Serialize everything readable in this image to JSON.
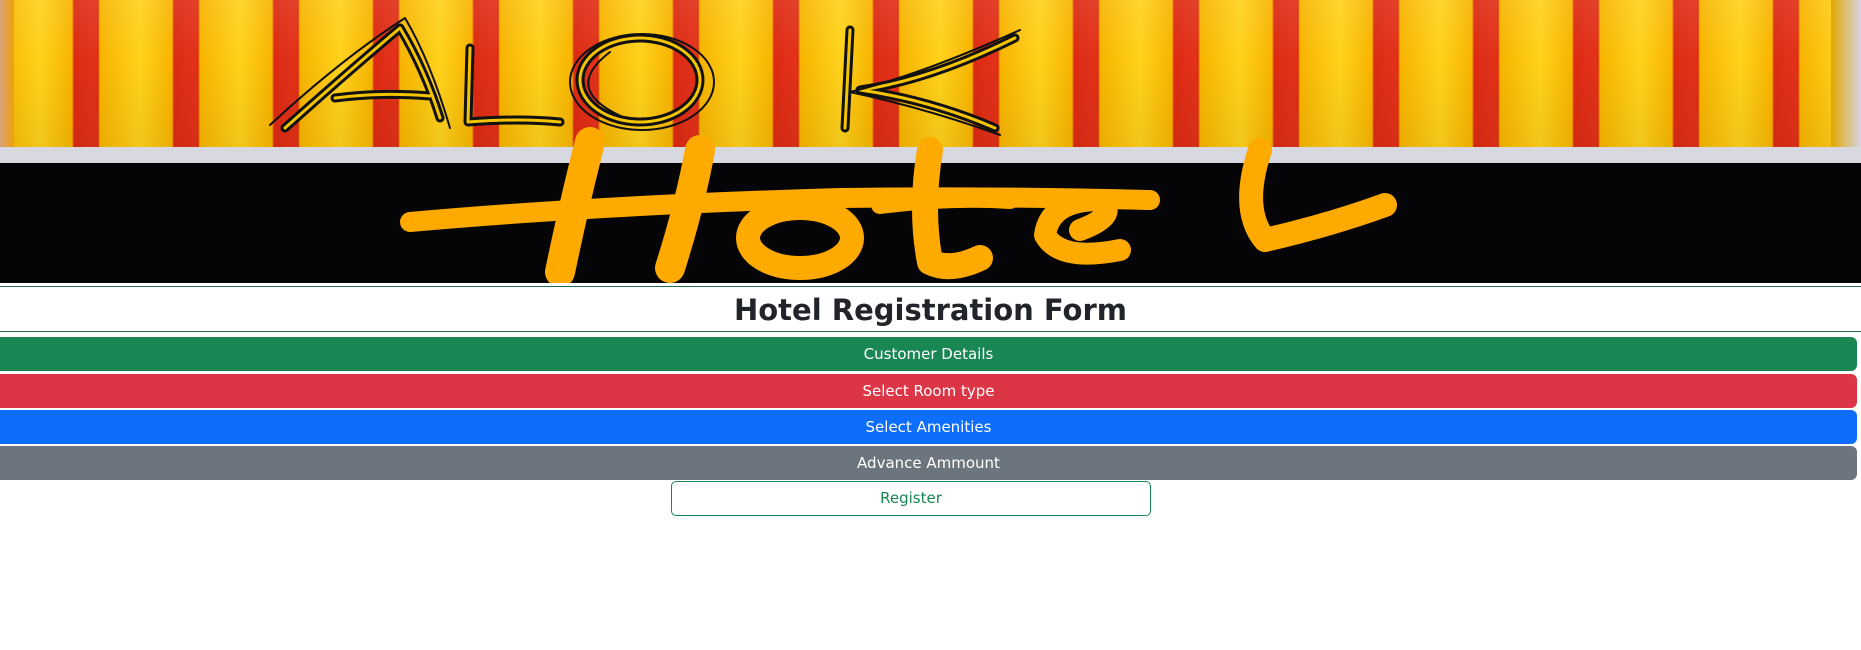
{
  "banner": {
    "logo_text_top": "ALOK",
    "logo_text_bottom": "Hotel",
    "colors": {
      "stripe_yellow": "#ffd21c",
      "stripe_red": "#dd2a12",
      "sign_black": "#050508",
      "hotel_orange": "#ffaa00"
    }
  },
  "form": {
    "title": "Hotel Registration Form",
    "sections": [
      {
        "label": "Customer Details",
        "color": "#198754"
      },
      {
        "label": "Select Room type",
        "color": "#dc3545"
      },
      {
        "label": "Select Amenities",
        "color": "#0d6efd"
      },
      {
        "label": "Advance Ammount",
        "color": "#6c757d"
      }
    ],
    "register_label": "Register",
    "register_color": "#198754"
  }
}
